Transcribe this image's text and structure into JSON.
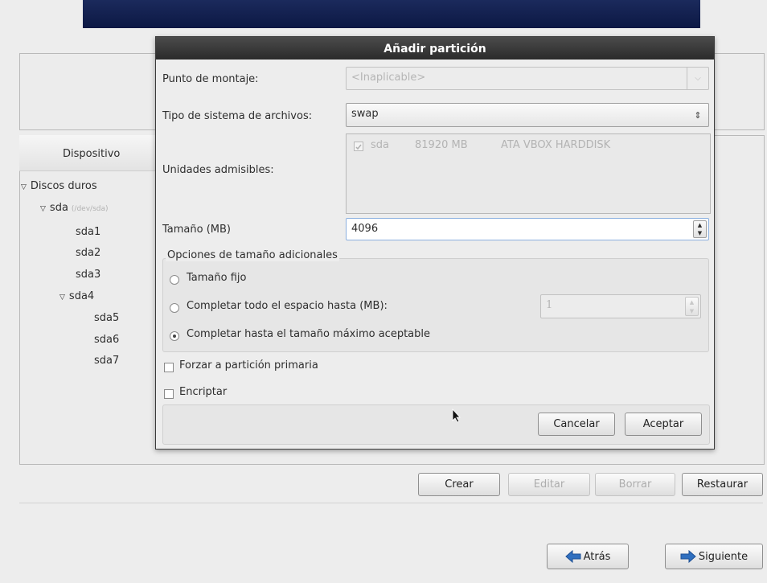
{
  "dialog": {
    "title": "Añadir partición",
    "mount_point_label": "Punto de montaje:",
    "mount_point_value": "<Inaplicable>",
    "fs_type_label": "Tipo de sistema de archivos:",
    "fs_type_value": "swap",
    "drives_label": "Unidades admisibles:",
    "drive": {
      "name": "sda",
      "size": "81920 MB",
      "model": "ATA VBOX HARDDISK"
    },
    "size_label": "Tamaño (MB)",
    "size_value": "4096",
    "size_options_legend": "Opciones de tamaño adicionales",
    "options": [
      {
        "label": "Tamaño fijo",
        "checked": false
      },
      {
        "label": "Completar todo el espacio hasta (MB):",
        "checked": false
      },
      {
        "label": "Completar hasta el tamaño máximo aceptable",
        "checked": true
      }
    ],
    "fill_up_to_value": "1",
    "force_primary_label": "Forzar a partición primaria",
    "encrypt_label": "Encriptar",
    "cancel_label": "Cancelar",
    "accept_label": "Aceptar"
  },
  "device_panel": {
    "header": "Dispositivo",
    "tree": [
      {
        "label": "Discos duros",
        "level": 0,
        "expanded": true
      },
      {
        "label": "sda",
        "sub": "(/dev/sda)",
        "level": 1,
        "expanded": true
      },
      {
        "label": "sda1",
        "level": 2
      },
      {
        "label": "sda2",
        "level": 2
      },
      {
        "label": "sda3",
        "level": 2
      },
      {
        "label": "sda4",
        "level": 2,
        "expanded": true
      },
      {
        "label": "sda5",
        "level": 3
      },
      {
        "label": "sda6",
        "level": 3
      },
      {
        "label": "sda7",
        "level": 3
      }
    ]
  },
  "actions": {
    "create": "Crear",
    "edit": "Editar",
    "delete": "Borrar",
    "reset": "Restaurar"
  },
  "nav": {
    "back": "Atrás",
    "next": "Siguiente"
  },
  "colors": {
    "banner": "#14214f",
    "dialog_title_bg": "#333333",
    "arrow_blue": "#2f6fbf"
  }
}
